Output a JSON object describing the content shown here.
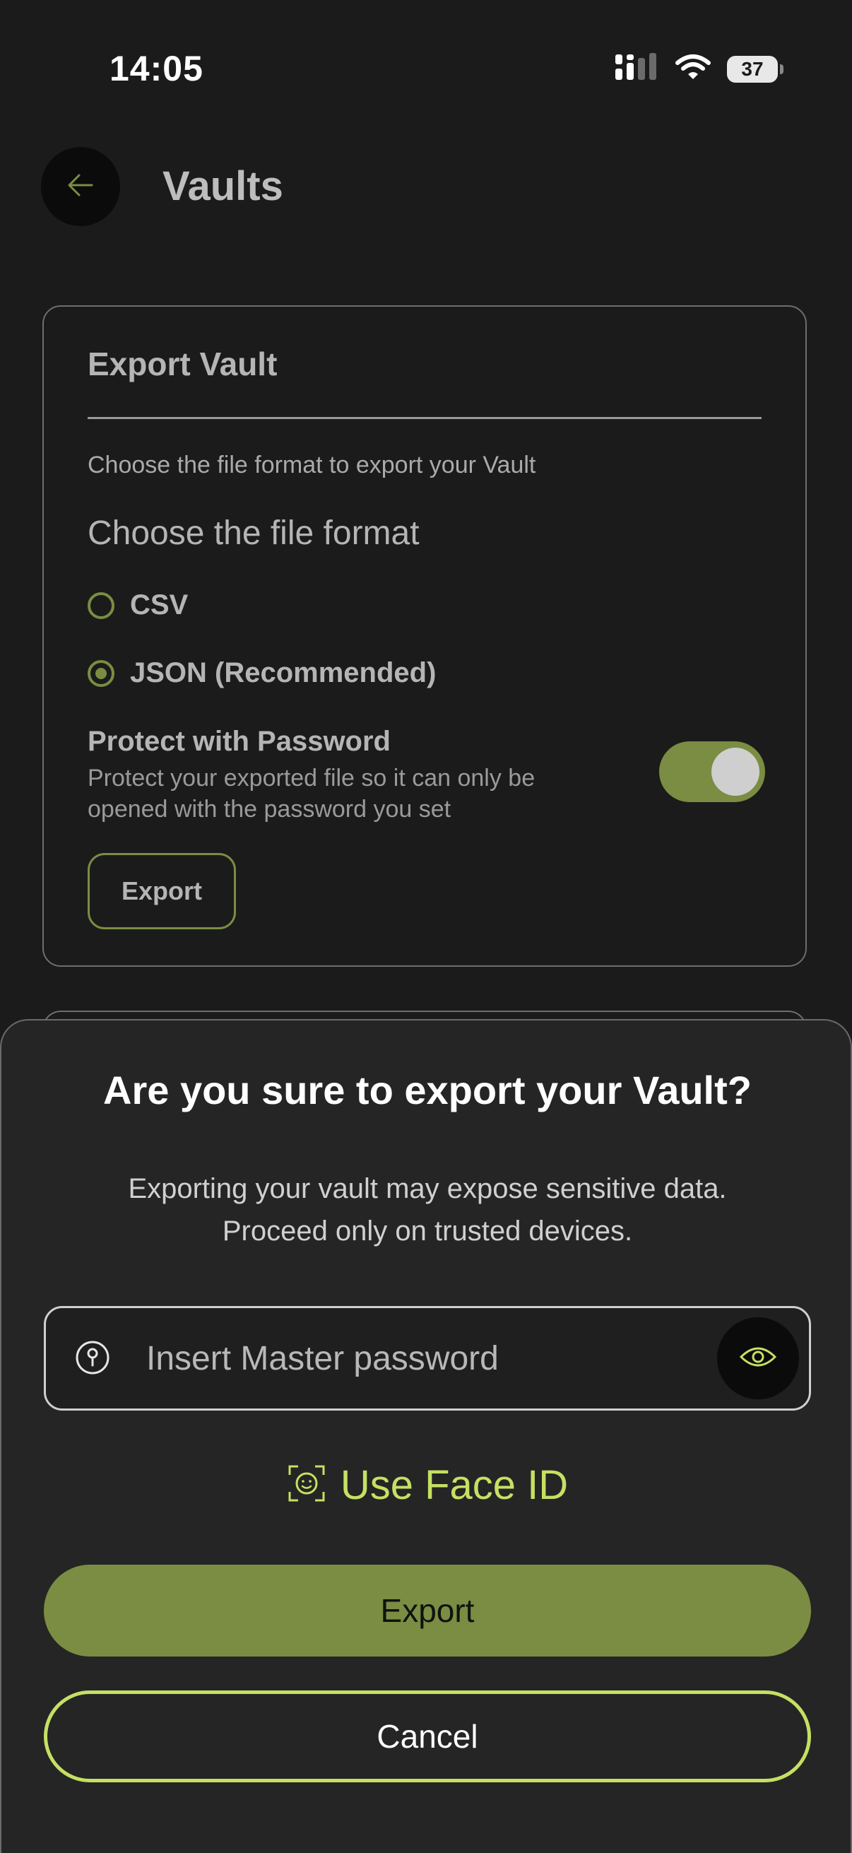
{
  "status_bar": {
    "time": "14:05",
    "battery": "37"
  },
  "header": {
    "title": "Vaults"
  },
  "export_card": {
    "title": "Export Vault",
    "description": "Choose the file format to export your Vault",
    "format_label": "Choose the file format",
    "options": [
      {
        "label": "CSV",
        "selected": false
      },
      {
        "label": "JSON (Recommended)",
        "selected": true
      }
    ],
    "protect_title": "Protect with Password",
    "protect_description": "Protect your exported file so it can only be opened with the password you set",
    "protect_enabled": true,
    "export_label": "Export"
  },
  "sheet": {
    "title": "Are you sure to export your Vault?",
    "description": "Exporting your vault may expose sensitive data. Proceed only on trusted devices.",
    "password_placeholder": "Insert Master password",
    "face_id_label": "Use Face ID",
    "export_label": "Export",
    "cancel_label": "Cancel"
  },
  "colors": {
    "accent": "#7a8d42",
    "accent_bright": "#c5e063",
    "background": "#1b1b1b"
  }
}
